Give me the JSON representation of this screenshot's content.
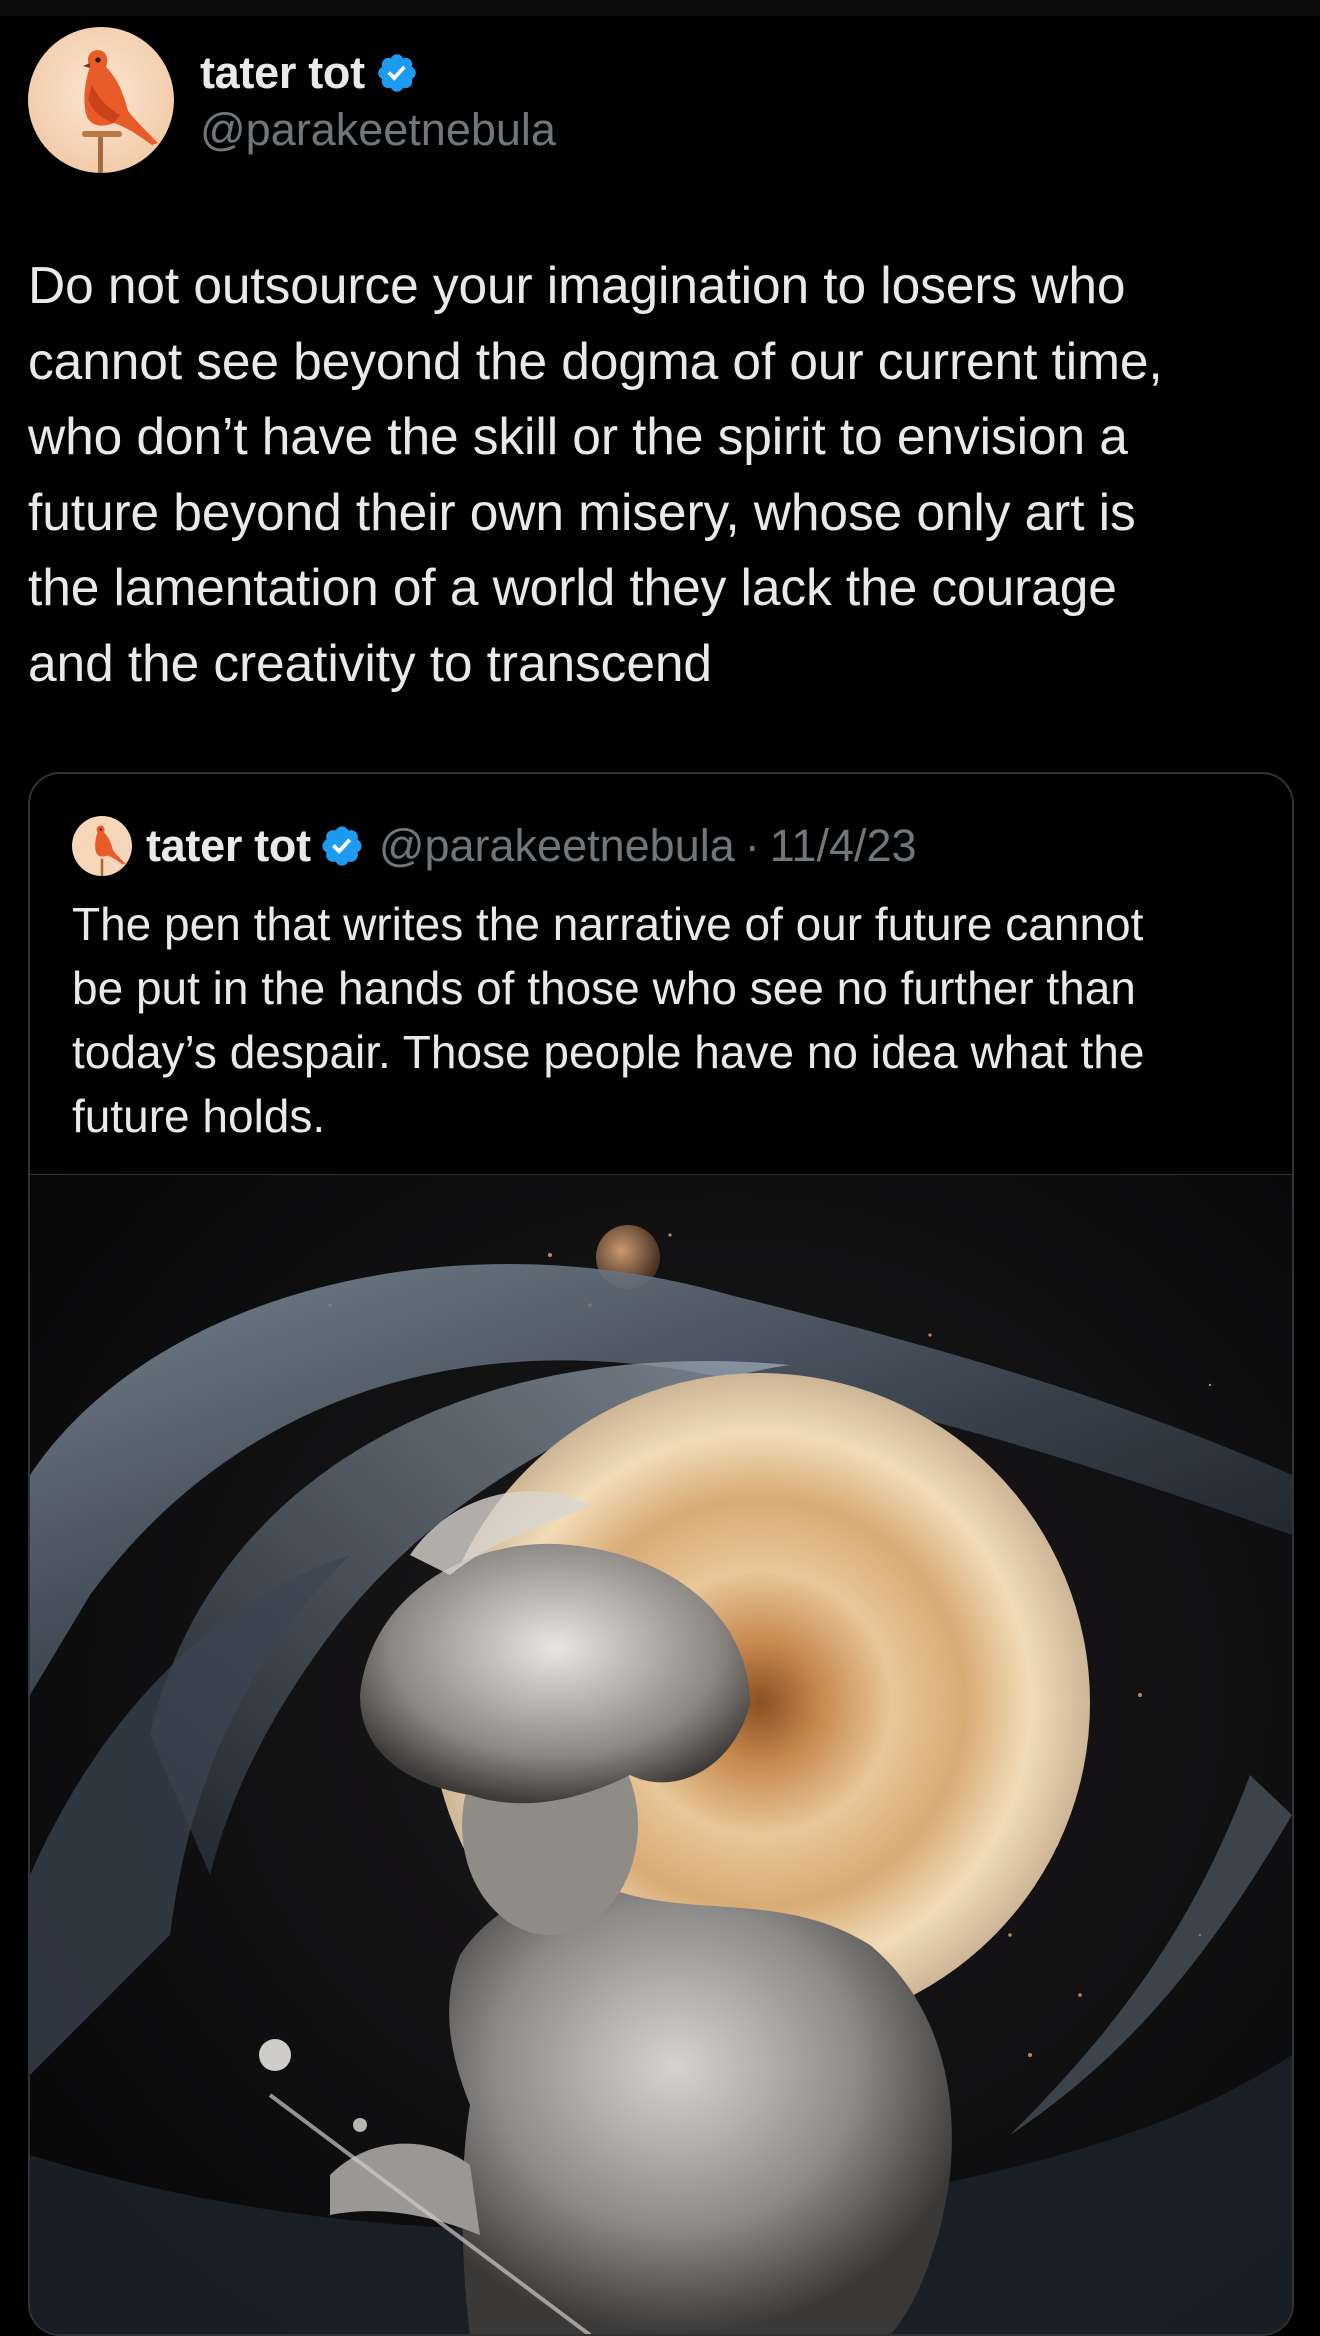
{
  "tweet": {
    "author": {
      "display_name": "tater tot",
      "handle": "@parakeetnebula",
      "verified": true,
      "avatar_icon": "parakeet-avatar-icon"
    },
    "text": "Do not outsource your imagination to losers who\ncannot see beyond the dogma of our current time,\nwho don’t have the skill or the spirit to envision a\nfuture beyond their own misery, whose only art is\nthe lamentation of a world they lack the courage\nand the creativity to transcend"
  },
  "quoted_tweet": {
    "author": {
      "display_name": "tater tot",
      "handle": "@parakeetnebula",
      "verified": true
    },
    "separator": "·",
    "date": "11/4/23",
    "text": "The pen that writes the narrative of our future cannot\nbe put in the hands of those who see no further than\ntoday’s despair. Those people have no idea what the\nfuture holds.",
    "image_icon": "cosmic-figure-artwork-image"
  },
  "colors": {
    "background": "#000000",
    "text_primary": "#e7e9ea",
    "text_secondary": "#71767b",
    "verified_blue": "#1d9bf0",
    "border": "#2f3336"
  }
}
